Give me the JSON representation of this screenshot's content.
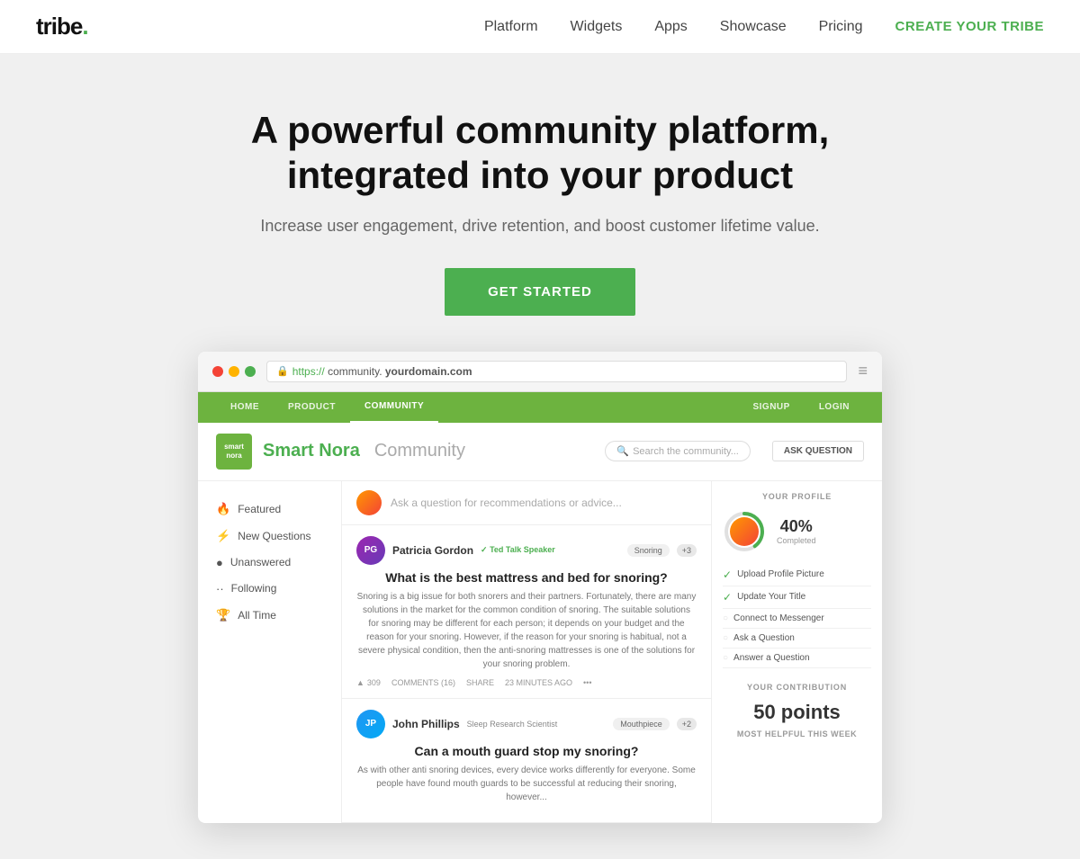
{
  "navbar": {
    "logo_text": "tribe",
    "logo_dot": ".",
    "nav_items": [
      {
        "label": "Platform",
        "id": "platform"
      },
      {
        "label": "Widgets",
        "id": "widgets"
      },
      {
        "label": "Apps",
        "id": "apps"
      },
      {
        "label": "Showcase",
        "id": "showcase"
      },
      {
        "label": "Pricing",
        "id": "pricing"
      }
    ],
    "cta_label": "CREATE YOUR TRIBE"
  },
  "hero": {
    "headline_line1": "A powerful community platform,",
    "headline_line2": "integrated into your product",
    "subtext": "Increase user engagement, drive retention, and boost customer lifetime value.",
    "cta_button": "GET STARTED"
  },
  "browser": {
    "url": "https://community.yourdomain.com",
    "url_protocol": "https://",
    "url_domain": "community.",
    "url_domain2": "yourdomain.com"
  },
  "community": {
    "nav_items": [
      "HOME",
      "PRODUCT",
      "COMMUNITY"
    ],
    "nav_active": "COMMUNITY",
    "nav_right": [
      "SIGNUP",
      "LOGIN"
    ],
    "brand_logo_text": "smart\nnora",
    "brand_name": "Smart Nora",
    "brand_community": "Community",
    "search_placeholder": "Search the community...",
    "ask_button": "ASK QUESTION",
    "sidebar_items": [
      {
        "icon": "🔥",
        "label": "Featured"
      },
      {
        "icon": "⚡",
        "label": "New Questions"
      },
      {
        "icon": "●",
        "label": "Unanswered"
      },
      {
        "icon": "··",
        "label": "Following"
      },
      {
        "icon": "🏆",
        "label": "All Time"
      }
    ],
    "ask_placeholder": "Ask a question for recommendations or advice...",
    "posts": [
      {
        "author": "Patricia Gordon",
        "badge": "✓ Ted Talk Speaker",
        "tag": "Snoring",
        "tag_num": "+3",
        "title": "What is the best mattress and bed for snoring?",
        "body": "Snoring is a big issue for both snorers and their partners. Fortunately, there are many solutions in the market for the common condition of snoring. The suitable solutions for snoring may be different for each person; it depends on your budget and the reason for your snoring. However, if the reason for your snoring is habitual, not a severe physical condition, then the anti-snoring mattresses is one of the solutions for your snoring problem.",
        "votes": "309",
        "comments": "COMMENTS (16)",
        "share": "SHARE",
        "time": "23 MINUTES AGO"
      },
      {
        "author": "John Phillips",
        "badge": "Sleep Research Scientist",
        "tag": "Mouthpiece",
        "tag_num": "+2",
        "title": "Can a mouth guard stop my snoring?",
        "body": "As with other anti snoring devices, every device works differently for everyone. Some people have found mouth guards to be successful at reducing their snoring, however..."
      }
    ],
    "right_panel": {
      "profile_title": "YOUR PROFILE",
      "completion_pct": "40%",
      "completion_label": "Completed",
      "profile_items": [
        {
          "checked": true,
          "label": "Upload Profile Picture"
        },
        {
          "checked": true,
          "label": "Update Your Title"
        },
        {
          "checked": false,
          "label": "Connect to Messenger"
        },
        {
          "checked": false,
          "label": "Ask a Question"
        },
        {
          "checked": false,
          "label": "Answer a Question"
        }
      ],
      "contribution_title": "YOUR CONTRIBUTION",
      "contribution_pts": "50 points",
      "most_helpful": "MOST HELPFUL THIS WEEK"
    }
  }
}
